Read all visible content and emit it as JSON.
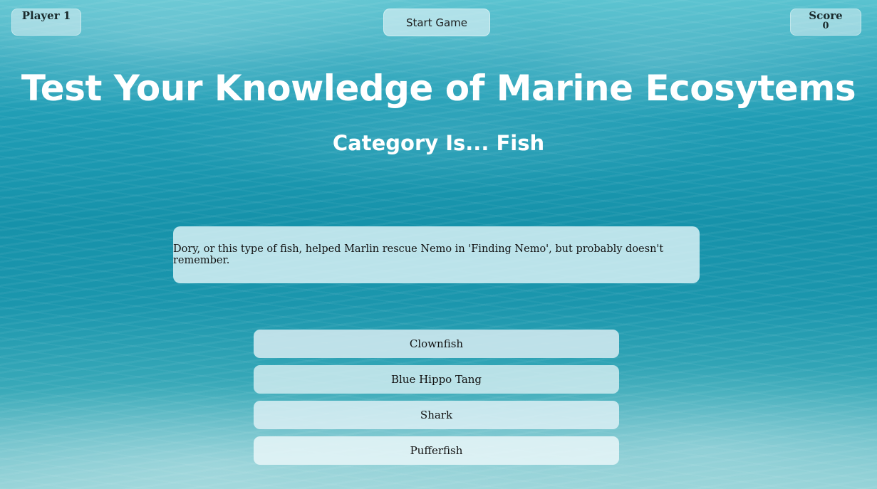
{
  "header": {
    "player_label": "Player 1",
    "start_button_label": "Start Game",
    "score_label": "Score",
    "score_value": "0"
  },
  "main": {
    "title": "Test Your Knowledge of Marine Ecosytems",
    "category": "Category Is... Fish",
    "question": "Dory, or this type of fish, helped Marlin rescue Nemo in 'Finding Nemo', but probably doesn't remember.",
    "answers": [
      {
        "label": "Clownfish"
      },
      {
        "label": "Blue Hippo Tang"
      },
      {
        "label": "Shark"
      },
      {
        "label": "Pufferfish"
      }
    ]
  },
  "colors": {
    "ocean_blue": "#1692aa",
    "title_text": "#ffffff",
    "panel_tint": "#d6f0f4"
  }
}
